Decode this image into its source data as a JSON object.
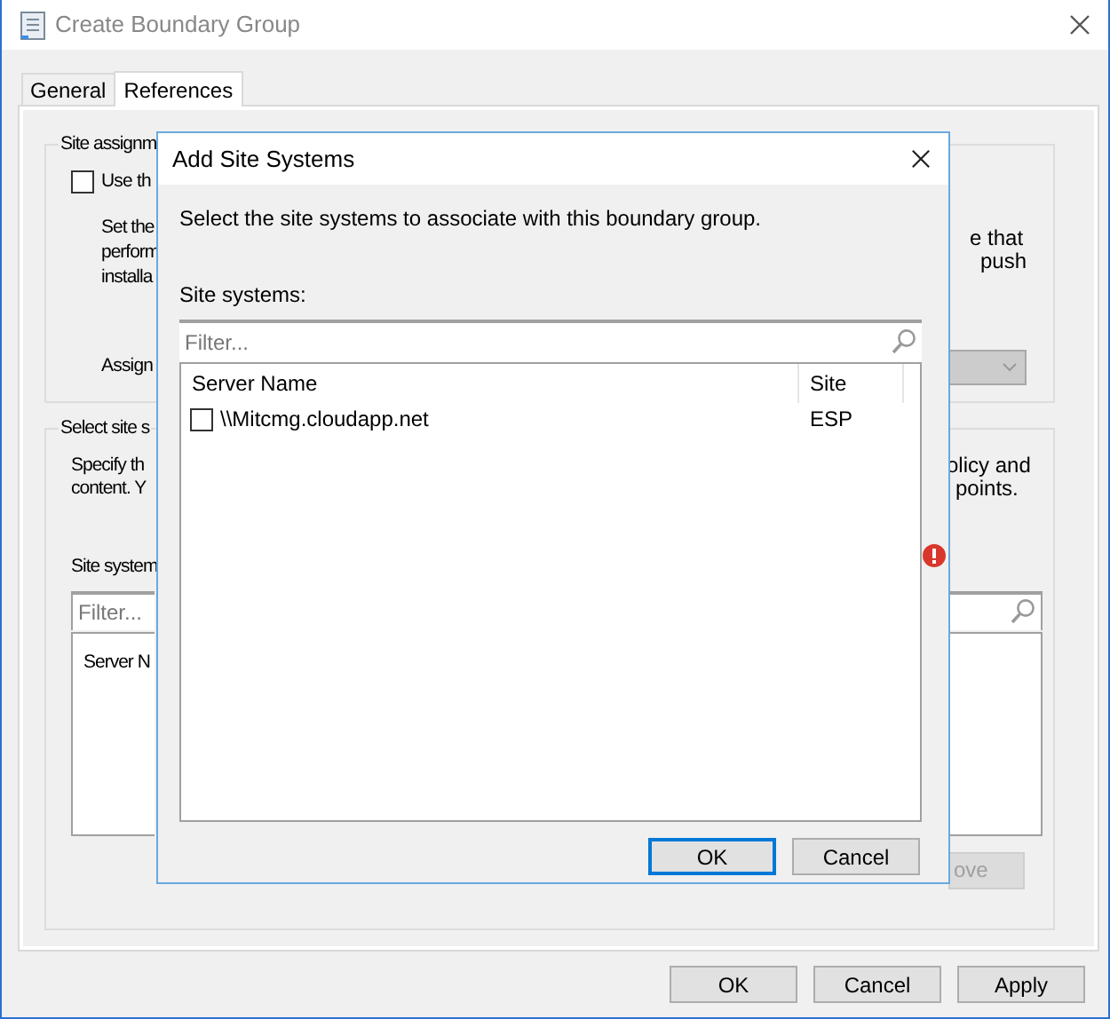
{
  "window": {
    "title": "Create Boundary Group"
  },
  "tabs": [
    {
      "label": "General",
      "selected": false
    },
    {
      "label": "References",
      "selected": true
    }
  ],
  "site_assignment": {
    "group_title": "Site assignm",
    "checkbox": {
      "label": "Use th",
      "checked": false
    },
    "description_left": [
      "Set the",
      "perform",
      "installa"
    ],
    "description_right": [
      "e that",
      "push"
    ],
    "assign_label": "Assign",
    "dropdown": {
      "disabled": true
    }
  },
  "site_systems_section": {
    "group_title": "Select site s",
    "description_left": [
      "Specify th",
      "content. Y"
    ],
    "description_right": [
      "olicy and",
      "points."
    ],
    "list_label": "Site system",
    "filter": {
      "placeholder": "Filter..."
    },
    "column_1": "Server N",
    "remove_button": {
      "label": "ove",
      "disabled": true
    }
  },
  "dialog": {
    "title": "Add Site Systems",
    "instruction": "Select the site systems to associate with this boundary group.",
    "list_label": "Site systems:",
    "filter": {
      "placeholder": "Filter..."
    },
    "columns": [
      "Server Name",
      "Site"
    ],
    "rows": [
      {
        "server_name": "\\\\Mitcmg.cloudapp.net",
        "site": "ESP",
        "checked": false
      }
    ],
    "buttons": [
      {
        "label": "OK",
        "default": true
      },
      {
        "label": "Cancel",
        "default": false
      }
    ]
  },
  "buttons": [
    {
      "label": "OK"
    },
    {
      "label": "Cancel"
    },
    {
      "label": "Apply"
    }
  ]
}
